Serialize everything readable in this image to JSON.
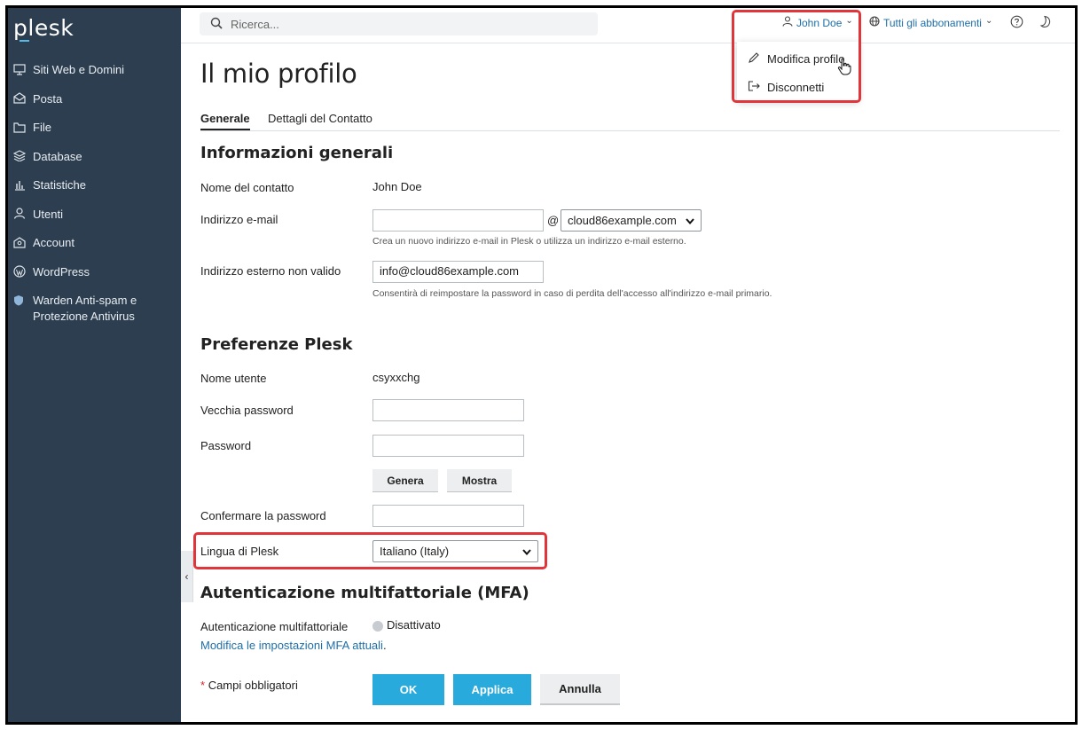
{
  "app": {
    "logo": "plesk"
  },
  "sidebar": {
    "items": [
      {
        "label": "Siti Web e Domini",
        "icon": "monitor-icon"
      },
      {
        "label": "Posta",
        "icon": "mail-icon"
      },
      {
        "label": "File",
        "icon": "folder-icon"
      },
      {
        "label": "Database",
        "icon": "database-icon"
      },
      {
        "label": "Statistiche",
        "icon": "bar-chart-icon"
      },
      {
        "label": "Utenti",
        "icon": "user-icon"
      },
      {
        "label": "Account",
        "icon": "account-icon"
      },
      {
        "label": "WordPress",
        "icon": "wordpress-icon"
      },
      {
        "label": "Warden Anti-spam e Protezione Antivirus",
        "icon": "shield-icon"
      }
    ],
    "collapse_glyph": "‹"
  },
  "topbar": {
    "search_placeholder": "Ricerca...",
    "user_name": "John Doe",
    "subscriptions": "Tutti gli abbonamenti",
    "chevron": "⌄"
  },
  "user_menu": {
    "items": [
      {
        "label": "Modifica profilo",
        "icon": "pencil-icon"
      },
      {
        "label": "Disconnetti",
        "icon": "logout-icon"
      }
    ]
  },
  "page": {
    "title": "Il mio profilo",
    "tabs": [
      {
        "label": "Generale",
        "active": true
      },
      {
        "label": "Dettagli del Contatto",
        "active": false
      }
    ]
  },
  "general": {
    "title": "Informazioni generali",
    "contact_name_label": "Nome del contatto",
    "contact_name_value": "John Doe",
    "email_label": "Indirizzo e-mail",
    "email_value": "",
    "at_sign": "@",
    "email_domain": "cloud86example.com",
    "email_hint": "Crea un nuovo indirizzo e-mail in Plesk o utilizza un indirizzo e-mail esterno.",
    "external_label": "Indirizzo esterno non valido",
    "external_value": "info@cloud86example.com",
    "external_hint": "Consentirà di reimpostare la password in caso di perdita dell'accesso all'indirizzo e-mail primario."
  },
  "preferences": {
    "title": "Preferenze Plesk",
    "username_label": "Nome utente",
    "username_value": "csyxxchg",
    "old_password_label": "Vecchia password",
    "password_label": "Password",
    "generate_button": "Genera",
    "show_button": "Mostra",
    "confirm_label": "Confermare la password",
    "language_label": "Lingua di Plesk",
    "language_value": "Italiano (Italy)"
  },
  "mfa": {
    "title": "Autenticazione multifattoriale (MFA)",
    "label": "Autenticazione multifattoriale",
    "status": "Disattivato",
    "link": "Modifica le impostazioni MFA attuali",
    "link_suffix": "."
  },
  "footer": {
    "required_star": "*",
    "required_text": "Campi obbligatori",
    "ok": "OK",
    "apply": "Applica",
    "cancel": "Annulla"
  },
  "colors": {
    "sidebar_bg": "#2d3e50",
    "accent_blue": "#28aadc",
    "link_blue": "#1e6fa8",
    "highlight_red": "#e0363b"
  }
}
